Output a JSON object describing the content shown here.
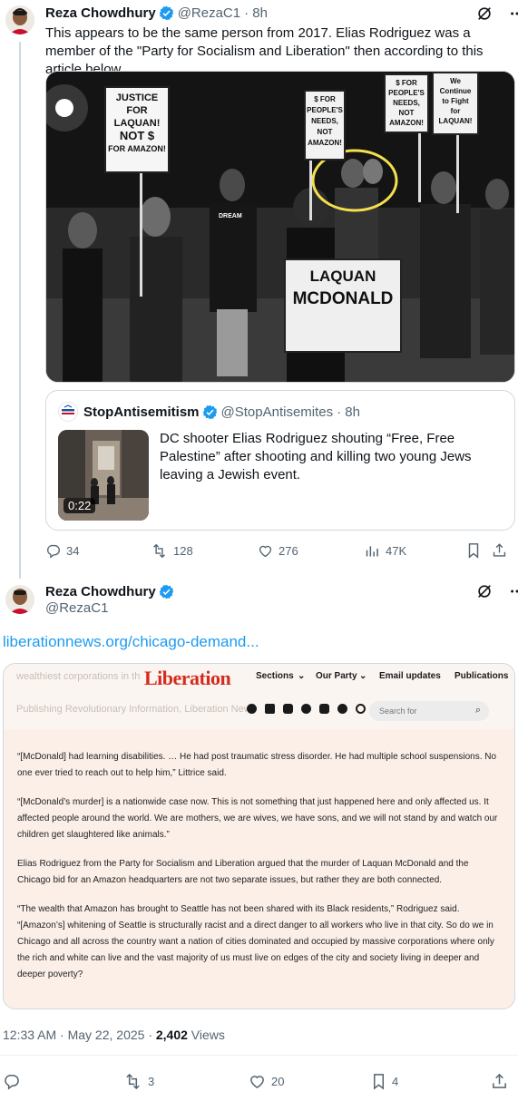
{
  "post1": {
    "author": "Reza Chowdhury",
    "handle": "@RezaC1",
    "time": "· 8h",
    "text": "This appears to be the same person from 2017. Elias Rodriguez was a member of the \"Party for Socialism and Liberation\" then according to this article below.",
    "photo": {
      "sign1": [
        "JUSTICE",
        "FOR",
        "LAQUAN!",
        "NOT $",
        "FOR AMAZON!"
      ],
      "sign2": [
        "$ FOR",
        "PEOPLE'S",
        "NEEDS,",
        "NOT",
        "AMAZON!"
      ],
      "sign3": [
        "$ FOR",
        "PEOPLE'S",
        "NEEDS,",
        "NOT",
        "AMAZON!"
      ],
      "sign4": [
        "We",
        "Continue",
        "to Fight",
        "for",
        "LAQUAN!"
      ],
      "sign5": [
        "LAQUAN",
        "MCDONALD"
      ],
      "shirt": "DREAM"
    },
    "quote": {
      "author": "StopAntisemitism",
      "handle": "@StopAntisemites",
      "time": "· 8h",
      "text": "DC shooter Elias Rodriguez shouting “Free, Free Palestine” after shooting and killing two young Jews leaving a Jewish event.",
      "duration": "0:22"
    },
    "stats": {
      "replies": "34",
      "reposts": "128",
      "likes": "276",
      "views": "47K"
    }
  },
  "post2": {
    "author": "Reza Chowdhury",
    "handle": "@RezaC1",
    "link": "liberationnews.org/chicago-demand...",
    "article": {
      "logo": "Liberation",
      "nav": [
        "Sections",
        "Our Party",
        "Email updates",
        "Publications"
      ],
      "search_placeholder": "Search for",
      "faint_top": "wealthiest corporations in th",
      "faint_mid": "Publishing Revolutionary Information, Liberation News",
      "paragraphs": [
        "“[McDonald] had learning disabilities. … He had post traumatic stress disorder. He had multiple school suspensions. No one ever tried to reach out to help him,” Littrice said.",
        "“[McDonald’s murder] is a nationwide case now. This is not something that just happened here and only affected us. It affected people around the world. We are mothers, we are wives, we have sons, and we will not stand by and watch our children get slaughtered like animals.”",
        "Elias Rodriguez from the Party for Socialism and Liberation argued that the murder of Laquan McDonald and the Chicago bid for an Amazon headquarters are not two separate issues, but rather they are both connected.",
        "“The wealth that Amazon has brought to Seattle has not been shared with its Black residents,” Rodriguez said. “[Amazon’s] whitening of Seattle is structurally racist and a direct danger to all workers who live in that city. So do we in Chicago and all across the country want a nation of cities dominated and occupied by massive corporations where only the rich and white can live and the vast majority of us must live on edges of the city and society living in deeper and deeper poverty?"
      ]
    },
    "timestamp": "12:33 AM · May 22, 2025 · ",
    "views_count": "2,402",
    "views_label": " Views",
    "stats": {
      "replies": "",
      "reposts": "3",
      "likes": "20",
      "bookmarks": "4"
    }
  },
  "colors": {
    "accent": "#1d9bf0",
    "muted": "#536471",
    "liberation_red": "#d52b1e"
  }
}
